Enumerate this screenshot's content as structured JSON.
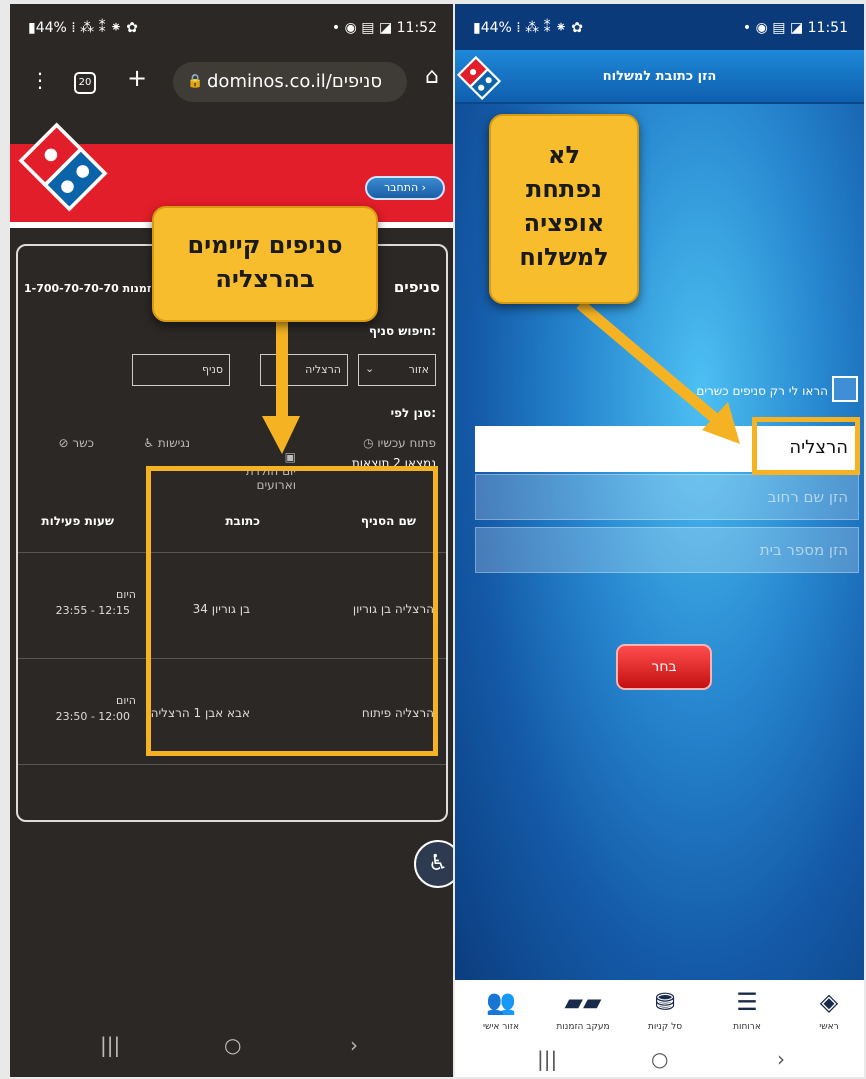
{
  "left": {
    "status": {
      "left": "▮44% ⁞ ⁂ ⁑ ⁕ ✿",
      "right": "• ◉ ▤ ◪ 11:52"
    },
    "chrome": {
      "url": "dominos.co.il/סניפים",
      "tabs_count": "20"
    },
    "connect_button": "התחבר ›",
    "phone": "1-700-70-70-70 הזמנות",
    "stores_title": "סניפים",
    "search_label": "חיפוש סניף:",
    "search": {
      "region": "אזור",
      "city": "הרצליה",
      "store_placeholder": "סניף"
    },
    "filter_label": "סנן לפי:",
    "filters": {
      "open_now": "פתוח עכשיו",
      "birthday": "יום הולדת\nוארועים",
      "accessible": "נגישות",
      "kosher": "כשר"
    },
    "results_count": "נמצאו 2 תוצאות",
    "table": {
      "headers": [
        "שם הסניף",
        "כתובת",
        "שעות פעילות"
      ],
      "rows": [
        {
          "name": "הרצליה בן גוריון",
          "address": "בן גוריון 34",
          "day": "היום",
          "hours": "23:55 - 12:15"
        },
        {
          "name": "הרצליה פיתוח",
          "address": "אבא אבן 1 הרצליה",
          "day": "היום",
          "hours": "23:50 - 12:00"
        }
      ]
    },
    "nav": {
      "recent": "|||",
      "home": "○",
      "back": "›"
    }
  },
  "right": {
    "status": {
      "left": "▮44% ⁞ ⁂ ⁑ ⁕ ✿",
      "right": "• ◉ ▤ ◪ 11:51"
    },
    "header_title": "הזן כתובת למשלוח",
    "kosher_label": "הראו לי רק סניפים כשרים",
    "city_value": "הרצליה",
    "street_placeholder": "הזן שם רחוב",
    "house_placeholder": "הזן מספר בית",
    "choose_button": "בחר",
    "tabs": [
      {
        "label": "ראשי",
        "icon": "domino-icon"
      },
      {
        "label": "ארוחות",
        "icon": "menu-list-icon"
      },
      {
        "label": "סל קניות",
        "icon": "basket-icon"
      },
      {
        "label": "מעקב הזמנות",
        "icon": "tracker-icon"
      },
      {
        "label": "אזור אישי",
        "icon": "users-icon"
      }
    ],
    "nav": {
      "recent": "|||",
      "home": "○",
      "back": "›"
    }
  },
  "callouts": {
    "left": "סניפים קיימים\nבהרצליה",
    "right": "לא\nנפתחת\nאופציה\nלמשלוח"
  },
  "colors": {
    "dominos_red": "#e21e2a",
    "dominos_blue": "#0b64a9",
    "callout_yellow": "#f7bd2c"
  }
}
